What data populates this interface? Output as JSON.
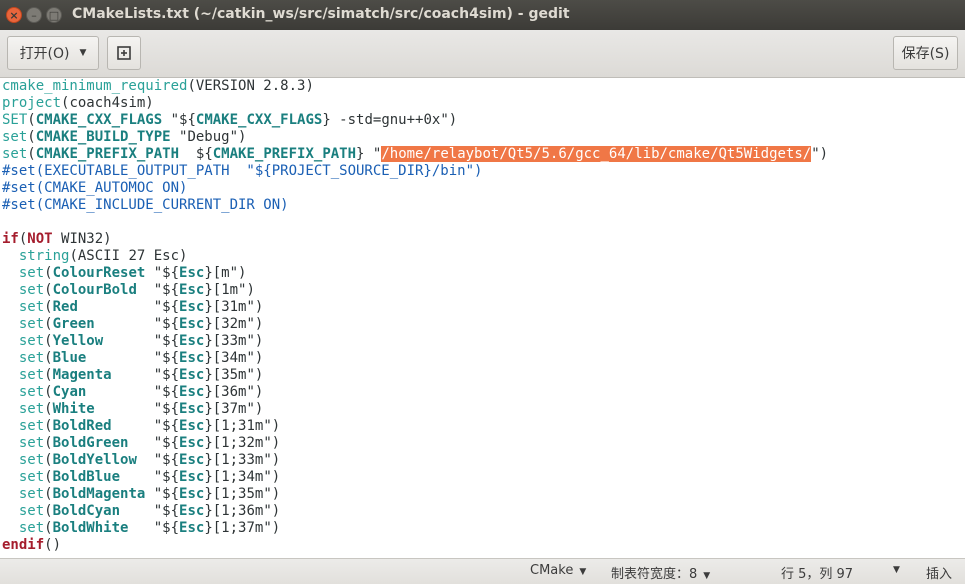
{
  "window": {
    "title": "CMakeLists.txt (~/catkin_ws/src/simatch/src/coach4sim) - gedit",
    "close_glyph": "×",
    "min_glyph": "–",
    "max_glyph": "□"
  },
  "toolbar": {
    "open_label": "打开(O)",
    "open_arrow": "▼",
    "new_doc_glyph": "⊞",
    "save_label": "保存(S)"
  },
  "editor": {
    "lines": [
      [
        {
          "t": "cmake_minimum_required",
          "c": "fn"
        },
        {
          "t": "(VERSION 2.8.3)",
          "c": ""
        }
      ],
      [
        {
          "t": "project",
          "c": "fn"
        },
        {
          "t": "(coach4sim)",
          "c": ""
        }
      ],
      [
        {
          "t": "SET",
          "c": "fn"
        },
        {
          "t": "(",
          "c": ""
        },
        {
          "t": "CMAKE_CXX_FLAGS",
          "c": "var"
        },
        {
          "t": " \"${",
          "c": ""
        },
        {
          "t": "CMAKE_CXX_FLAGS",
          "c": "var"
        },
        {
          "t": "} -std=gnu++0x\")",
          "c": ""
        }
      ],
      [
        {
          "t": "set",
          "c": "fn"
        },
        {
          "t": "(",
          "c": ""
        },
        {
          "t": "CMAKE_BUILD_TYPE",
          "c": "var"
        },
        {
          "t": " \"Debug\")",
          "c": ""
        }
      ],
      [
        {
          "t": "set",
          "c": "fn"
        },
        {
          "t": "(",
          "c": ""
        },
        {
          "t": "CMAKE_PREFIX_PATH",
          "c": "var"
        },
        {
          "t": "  ${",
          "c": ""
        },
        {
          "t": "CMAKE_PREFIX_PATH",
          "c": "var"
        },
        {
          "t": "} \"",
          "c": ""
        },
        {
          "t": "/home/relaybot/Qt5/5.6/gcc_64/lib/cmake/Qt5Widgets/",
          "c": "sel"
        },
        {
          "t": "\")",
          "c": ""
        }
      ],
      [
        {
          "t": "#set(EXECUTABLE_OUTPUT_PATH  \"${PROJECT_SOURCE_DIR}/bin\")",
          "c": "com"
        }
      ],
      [
        {
          "t": "#set(CMAKE_AUTOMOC ON)",
          "c": "com"
        }
      ],
      [
        {
          "t": "#set(CMAKE_INCLUDE_CURRENT_DIR ON)",
          "c": "com"
        }
      ],
      [],
      [
        {
          "t": "if",
          "c": "kw"
        },
        {
          "t": "(",
          "c": ""
        },
        {
          "t": "NOT",
          "c": "kw"
        },
        {
          "t": " WIN32)",
          "c": ""
        }
      ],
      [
        {
          "t": "  ",
          "c": ""
        },
        {
          "t": "string",
          "c": "fn"
        },
        {
          "t": "(ASCII 27 Esc)",
          "c": ""
        }
      ],
      [
        {
          "t": "  ",
          "c": ""
        },
        {
          "t": "set",
          "c": "fn"
        },
        {
          "t": "(",
          "c": ""
        },
        {
          "t": "ColourReset",
          "c": "var"
        },
        {
          "t": " \"${",
          "c": ""
        },
        {
          "t": "Esc",
          "c": "var"
        },
        {
          "t": "}[m\")",
          "c": ""
        }
      ],
      [
        {
          "t": "  ",
          "c": ""
        },
        {
          "t": "set",
          "c": "fn"
        },
        {
          "t": "(",
          "c": ""
        },
        {
          "t": "ColourBold",
          "c": "var"
        },
        {
          "t": "  \"${",
          "c": ""
        },
        {
          "t": "Esc",
          "c": "var"
        },
        {
          "t": "}[1m\")",
          "c": ""
        }
      ],
      [
        {
          "t": "  ",
          "c": ""
        },
        {
          "t": "set",
          "c": "fn"
        },
        {
          "t": "(",
          "c": ""
        },
        {
          "t": "Red",
          "c": "var"
        },
        {
          "t": "         \"${",
          "c": ""
        },
        {
          "t": "Esc",
          "c": "var"
        },
        {
          "t": "}[31m\")",
          "c": ""
        }
      ],
      [
        {
          "t": "  ",
          "c": ""
        },
        {
          "t": "set",
          "c": "fn"
        },
        {
          "t": "(",
          "c": ""
        },
        {
          "t": "Green",
          "c": "var"
        },
        {
          "t": "       \"${",
          "c": ""
        },
        {
          "t": "Esc",
          "c": "var"
        },
        {
          "t": "}[32m\")",
          "c": ""
        }
      ],
      [
        {
          "t": "  ",
          "c": ""
        },
        {
          "t": "set",
          "c": "fn"
        },
        {
          "t": "(",
          "c": ""
        },
        {
          "t": "Yellow",
          "c": "var"
        },
        {
          "t": "      \"${",
          "c": ""
        },
        {
          "t": "Esc",
          "c": "var"
        },
        {
          "t": "}[33m\")",
          "c": ""
        }
      ],
      [
        {
          "t": "  ",
          "c": ""
        },
        {
          "t": "set",
          "c": "fn"
        },
        {
          "t": "(",
          "c": ""
        },
        {
          "t": "Blue",
          "c": "var"
        },
        {
          "t": "        \"${",
          "c": ""
        },
        {
          "t": "Esc",
          "c": "var"
        },
        {
          "t": "}[34m\")",
          "c": ""
        }
      ],
      [
        {
          "t": "  ",
          "c": ""
        },
        {
          "t": "set",
          "c": "fn"
        },
        {
          "t": "(",
          "c": ""
        },
        {
          "t": "Magenta",
          "c": "var"
        },
        {
          "t": "     \"${",
          "c": ""
        },
        {
          "t": "Esc",
          "c": "var"
        },
        {
          "t": "}[35m\")",
          "c": ""
        }
      ],
      [
        {
          "t": "  ",
          "c": ""
        },
        {
          "t": "set",
          "c": "fn"
        },
        {
          "t": "(",
          "c": ""
        },
        {
          "t": "Cyan",
          "c": "var"
        },
        {
          "t": "        \"${",
          "c": ""
        },
        {
          "t": "Esc",
          "c": "var"
        },
        {
          "t": "}[36m\")",
          "c": ""
        }
      ],
      [
        {
          "t": "  ",
          "c": ""
        },
        {
          "t": "set",
          "c": "fn"
        },
        {
          "t": "(",
          "c": ""
        },
        {
          "t": "White",
          "c": "var"
        },
        {
          "t": "       \"${",
          "c": ""
        },
        {
          "t": "Esc",
          "c": "var"
        },
        {
          "t": "}[37m\")",
          "c": ""
        }
      ],
      [
        {
          "t": "  ",
          "c": ""
        },
        {
          "t": "set",
          "c": "fn"
        },
        {
          "t": "(",
          "c": ""
        },
        {
          "t": "BoldRed",
          "c": "var"
        },
        {
          "t": "     \"${",
          "c": ""
        },
        {
          "t": "Esc",
          "c": "var"
        },
        {
          "t": "}[1;31m\")",
          "c": ""
        }
      ],
      [
        {
          "t": "  ",
          "c": ""
        },
        {
          "t": "set",
          "c": "fn"
        },
        {
          "t": "(",
          "c": ""
        },
        {
          "t": "BoldGreen",
          "c": "var"
        },
        {
          "t": "   \"${",
          "c": ""
        },
        {
          "t": "Esc",
          "c": "var"
        },
        {
          "t": "}[1;32m\")",
          "c": ""
        }
      ],
      [
        {
          "t": "  ",
          "c": ""
        },
        {
          "t": "set",
          "c": "fn"
        },
        {
          "t": "(",
          "c": ""
        },
        {
          "t": "BoldYellow",
          "c": "var"
        },
        {
          "t": "  \"${",
          "c": ""
        },
        {
          "t": "Esc",
          "c": "var"
        },
        {
          "t": "}[1;33m\")",
          "c": ""
        }
      ],
      [
        {
          "t": "  ",
          "c": ""
        },
        {
          "t": "set",
          "c": "fn"
        },
        {
          "t": "(",
          "c": ""
        },
        {
          "t": "BoldBlue",
          "c": "var"
        },
        {
          "t": "    \"${",
          "c": ""
        },
        {
          "t": "Esc",
          "c": "var"
        },
        {
          "t": "}[1;34m\")",
          "c": ""
        }
      ],
      [
        {
          "t": "  ",
          "c": ""
        },
        {
          "t": "set",
          "c": "fn"
        },
        {
          "t": "(",
          "c": ""
        },
        {
          "t": "BoldMagenta",
          "c": "var"
        },
        {
          "t": " \"${",
          "c": ""
        },
        {
          "t": "Esc",
          "c": "var"
        },
        {
          "t": "}[1;35m\")",
          "c": ""
        }
      ],
      [
        {
          "t": "  ",
          "c": ""
        },
        {
          "t": "set",
          "c": "fn"
        },
        {
          "t": "(",
          "c": ""
        },
        {
          "t": "BoldCyan",
          "c": "var"
        },
        {
          "t": "    \"${",
          "c": ""
        },
        {
          "t": "Esc",
          "c": "var"
        },
        {
          "t": "}[1;36m\")",
          "c": ""
        }
      ],
      [
        {
          "t": "  ",
          "c": ""
        },
        {
          "t": "set",
          "c": "fn"
        },
        {
          "t": "(",
          "c": ""
        },
        {
          "t": "BoldWhite",
          "c": "var"
        },
        {
          "t": "   \"${",
          "c": ""
        },
        {
          "t": "Esc",
          "c": "var"
        },
        {
          "t": "}[1;37m\")",
          "c": ""
        }
      ],
      [
        {
          "t": "endif",
          "c": "kw"
        },
        {
          "t": "()",
          "c": ""
        }
      ]
    ]
  },
  "statusbar": {
    "language": "CMake",
    "tab_width": "制表符宽度：8",
    "position": "行 5，列 97",
    "dropdown_glyph": "▼",
    "insert_mode": "插入"
  },
  "colors": {
    "titlebar": "#3c3b37",
    "selection": "#f07746",
    "function": "#2aa198",
    "variable": "#1a7f7f",
    "comment": "#1a5fb4",
    "keyword": "#a51d2d"
  }
}
